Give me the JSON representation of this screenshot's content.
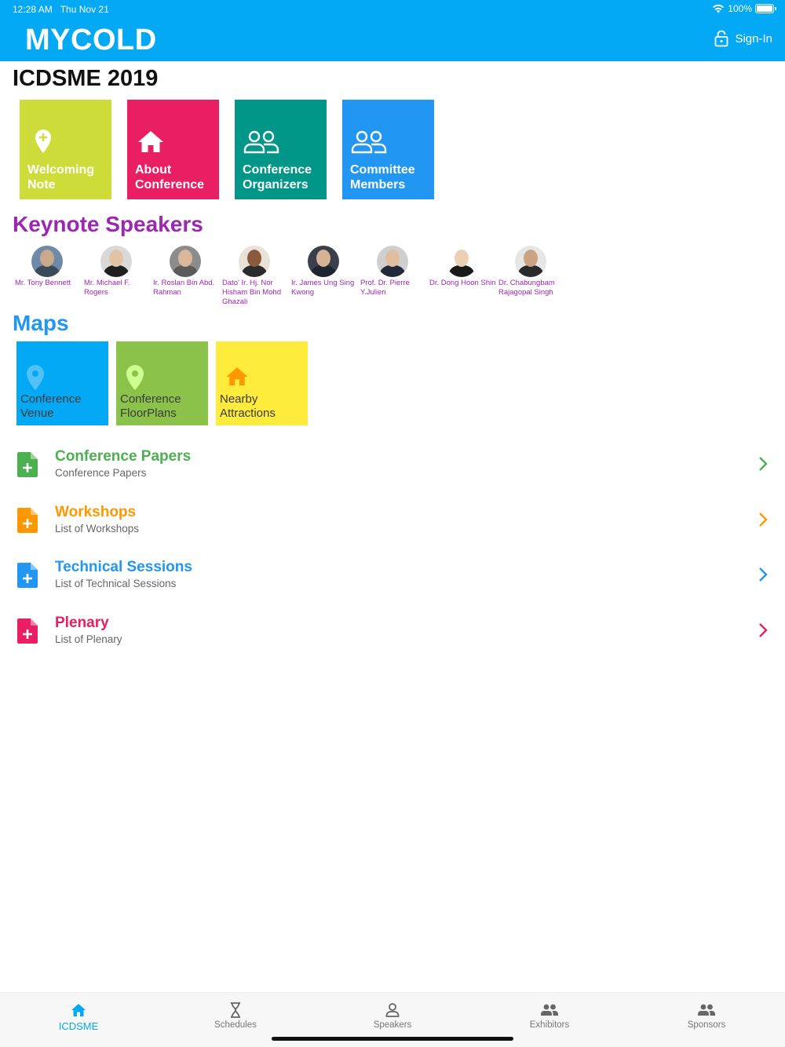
{
  "status": {
    "time": "12:28 AM",
    "date": "Thu Nov 21",
    "battery": "100%",
    "battery_level": 1.0
  },
  "header": {
    "title": "MYCOLD",
    "signin_label": "Sign-In"
  },
  "conference_title": "ICDSME 2019",
  "tiles": [
    {
      "line1": "Welcoming",
      "line2": "Note",
      "color": "#cddc39",
      "icon": "location-pin-plus-icon"
    },
    {
      "line1": "About",
      "line2": "Conference",
      "color": "#e91e63",
      "icon": "home-icon"
    },
    {
      "line1": "Conference",
      "line2": "Organizers",
      "color": "#009688",
      "icon": "people-icon"
    },
    {
      "line1": "Committee",
      "line2": "Members",
      "color": "#2196f3",
      "icon": "people-icon"
    }
  ],
  "keynote": {
    "title": "Keynote Speakers",
    "speakers": [
      {
        "name": "Mr. Tony Bennett"
      },
      {
        "name": "Mr. Michael F. Rogers"
      },
      {
        "name": "Ir. Roslan Bin Abd. Rahman"
      },
      {
        "name": "Dato' Ir. Hj. Nor Hisham Bin Mohd Ghazali"
      },
      {
        "name": "Ir. James Ung Sing Kwong"
      },
      {
        "name": "Prof. Dr. Pierre Y.Julien"
      },
      {
        "name": "Dr. Dong Hoon Shin"
      },
      {
        "name": "Dr. Chabungbam Rajagopal Singh"
      }
    ]
  },
  "maps": {
    "title": "Maps",
    "items": [
      {
        "line1": "Conference",
        "line2": "Venue",
        "color": "#03a9f4",
        "icon": "location-pin-icon",
        "icon_color": "#4fc3f7"
      },
      {
        "line1": "Conference",
        "line2": "FloorPlans",
        "color": "#8bc34a",
        "icon": "location-pin-icon",
        "icon_color": "#ccff90"
      },
      {
        "line1": "Nearby",
        "line2": "Attractions",
        "color": "#ffeb3b",
        "icon": "home-icon",
        "icon_color": "#ff9800"
      }
    ]
  },
  "list": [
    {
      "title": "Conference Papers",
      "subtitle": "Conference Papers",
      "color": "#4caf50",
      "icon": "document-plus-icon"
    },
    {
      "title": "Workshops",
      "subtitle": "List of Workshops",
      "color": "#ff9800",
      "icon": "document-plus-icon"
    },
    {
      "title": "Technical Sessions",
      "subtitle": "List of Technical Sessions",
      "color": "#2196f3",
      "icon": "document-plus-icon"
    },
    {
      "title": "Plenary",
      "subtitle": "List of Plenary",
      "color": "#e91e63",
      "icon": "document-plus-icon"
    }
  ],
  "nav": [
    {
      "label": "ICDSME",
      "icon": "home-icon",
      "active": true
    },
    {
      "label": "Schedules",
      "icon": "hourglass-icon",
      "active": false
    },
    {
      "label": "Speakers",
      "icon": "person-icon",
      "active": false
    },
    {
      "label": "Exhibitors",
      "icon": "people-icon",
      "active": false
    },
    {
      "label": "Sponsors",
      "icon": "people-icon",
      "active": false
    }
  ]
}
